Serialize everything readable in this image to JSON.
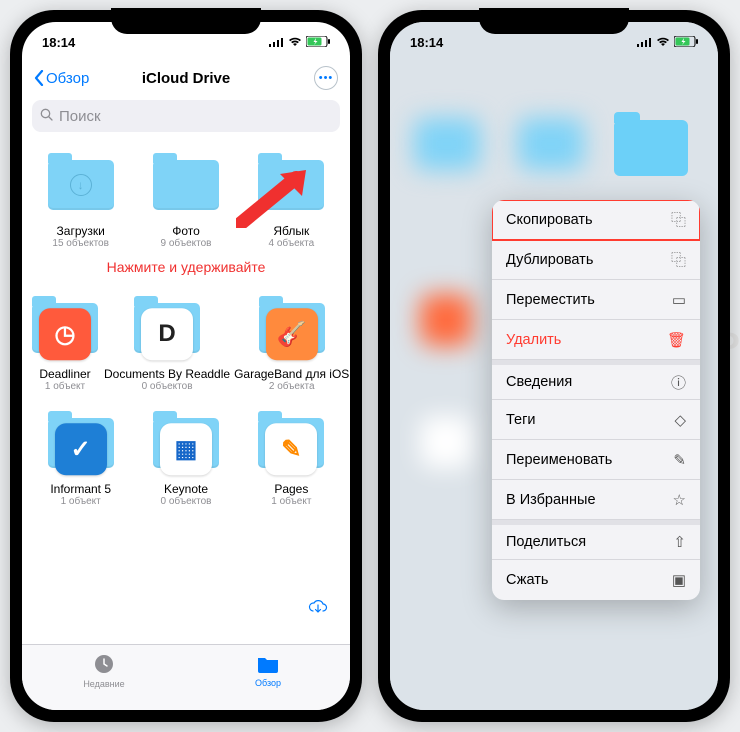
{
  "status": {
    "time": "18:14"
  },
  "nav": {
    "back": "Обзор",
    "title": "iCloud Drive"
  },
  "search": {
    "placeholder": "Поиск"
  },
  "instruction": "Нажмите и удерживайте",
  "folders": [
    {
      "label": "Загрузки",
      "sub": "15 объектов",
      "type": "folder-dl"
    },
    {
      "label": "Фото",
      "sub": "9 объектов",
      "type": "folder"
    },
    {
      "label": "Яблык",
      "sub": "4 объекта",
      "type": "folder"
    }
  ],
  "apps1": [
    {
      "label": "Deadliner",
      "sub": "1 объект",
      "color": "#ff5a3c",
      "glyph": "◷"
    },
    {
      "label": "Documents By Readdle",
      "sub": "0 объектов",
      "color": "#ffffff",
      "glyph": "D",
      "fg": "#222"
    },
    {
      "label": "GarageBand для iOS",
      "sub": "2 объекта",
      "color": "#ff8a3d",
      "glyph": "🎸"
    }
  ],
  "apps2": [
    {
      "label": "Informant 5",
      "sub": "1 объект",
      "color": "#1e7fd6",
      "glyph": "✓"
    },
    {
      "label": "Keynote",
      "sub": "0 объектов",
      "color": "#ffffff",
      "glyph": "▦",
      "fg": "#1667c9"
    },
    {
      "label": "Pages",
      "sub": "1 объект",
      "color": "#ffffff",
      "glyph": "✎",
      "fg": "#ff8a00"
    }
  ],
  "tabs": {
    "recent": "Недавние",
    "browse": "Обзор"
  },
  "context_menu": [
    {
      "label": "Скопировать",
      "icon": "⿻",
      "highlight": true
    },
    {
      "label": "Дублировать",
      "icon": "⿻"
    },
    {
      "label": "Переместить",
      "icon": "▭"
    },
    {
      "label": "Удалить",
      "icon": "🗑",
      "destructive": true
    },
    {
      "label": "Сведения",
      "icon": "ⓘ",
      "sep": true
    },
    {
      "label": "Теги",
      "icon": "◇"
    },
    {
      "label": "Переименовать",
      "icon": "✎"
    },
    {
      "label": "В Избранные",
      "icon": "☆"
    },
    {
      "label": "Поделиться",
      "icon": "⇧",
      "sep": true
    },
    {
      "label": "Сжать",
      "icon": "▣"
    }
  ]
}
